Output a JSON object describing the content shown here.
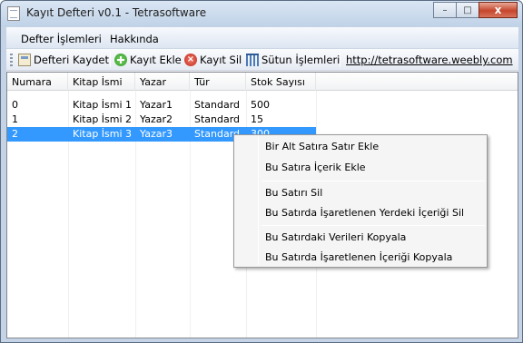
{
  "window": {
    "title": "Kayıt Defteri v0.1 - Tetrasoftware",
    "minimize": "–",
    "maximize": "□",
    "close": "x"
  },
  "menu": {
    "items": [
      "Defter İşlemleri",
      "Hakkında"
    ]
  },
  "toolbar": {
    "save_label": "Defteri Kaydet",
    "add_label": "Kayıt Ekle",
    "delete_label": "Kayıt Sil",
    "columns_label": "Sütun İşlemleri",
    "link_label": "http://tetrasoftware.weebly.com"
  },
  "table": {
    "headers": [
      "Numara",
      "Kitap İsmi",
      "Yazar",
      "Tür",
      "Stok Sayısı"
    ],
    "rows": [
      [
        "0",
        "Kitap İsmi 1",
        "Yazar1",
        "Standard",
        "500"
      ],
      [
        "1",
        "Kitap İsmi 2",
        "Yazar2",
        "Standard",
        "15"
      ],
      [
        "2",
        "Kitap İsmi 3",
        "Yazar3",
        "Standard",
        "300"
      ]
    ],
    "selected_row_index": 2
  },
  "context_menu": {
    "items": [
      "Bir Alt Satıra Satır Ekle",
      "Bu Satıra İçerik Ekle",
      "Bu Satırı Sil",
      "Bu Satırda İşaretlenen Yerdeki İçeriği Sil",
      "Bu Satırdaki Verileri Kopyala",
      "Bu Satırda İşaretlenen İçeriği Kopyala"
    ]
  },
  "colors": {
    "selection": "#3399ff",
    "title_bar": "#c4d3e5"
  }
}
